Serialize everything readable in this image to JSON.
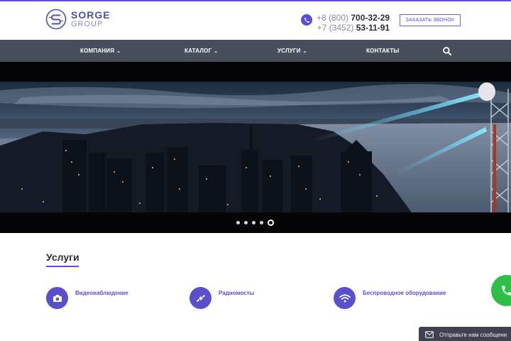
{
  "brand": {
    "name": "SORGE",
    "sub": "GROUP",
    "accent": "#5a4fcf"
  },
  "contacts": {
    "phone1_prefix": "+8 (800)",
    "phone1_number": "700-32-29",
    "phone2_prefix": "+7 (3452)",
    "phone2_number": "53-11-91",
    "icon": "phone-icon"
  },
  "header": {
    "callback_label": "ЗАКАЗАТЬ ЗВОНОК"
  },
  "nav": {
    "items": [
      {
        "label": "КОМПАНИЯ",
        "has_dropdown": true
      },
      {
        "label": "КАТАЛОГ",
        "has_dropdown": true
      },
      {
        "label": "УСЛУГИ",
        "has_dropdown": true
      },
      {
        "label": "КОНТАКТЫ",
        "has_dropdown": false
      }
    ],
    "search_icon": "search-icon",
    "background": "#494e5c"
  },
  "hero": {
    "slide_count": 5,
    "active_slide": 5
  },
  "services": {
    "title": "Услуги",
    "items": [
      {
        "label": "Видеонаблюдение",
        "icon": "camera-icon"
      },
      {
        "label": "Радиомосты",
        "icon": "satellite-icon"
      },
      {
        "label": "Беспроводное оборудование",
        "icon": "wifi-icon"
      }
    ]
  },
  "widgets": {
    "whatsapp_icon": "whatsapp-phone-icon",
    "whatsapp_color": "#2fbf48",
    "chat_label": "Отправьте нам сообщени",
    "chat_icon": "message-icon"
  }
}
